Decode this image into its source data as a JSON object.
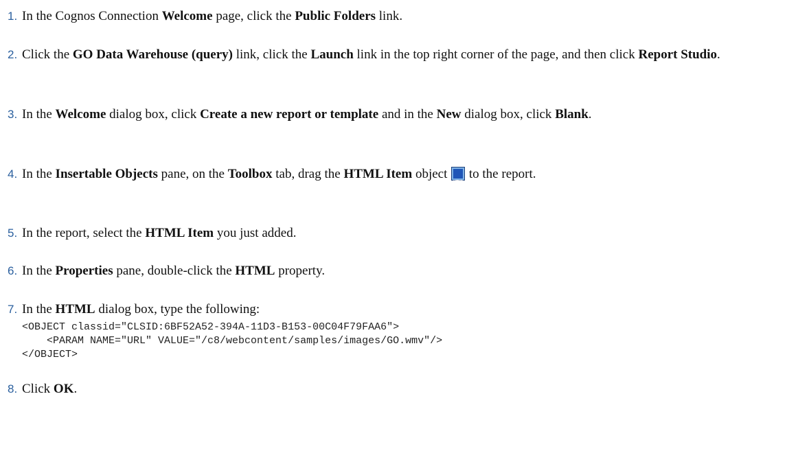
{
  "steps": [
    {
      "num": "1.",
      "parts": [
        {
          "t": "In the Cognos Connection "
        },
        {
          "t": "Welcome",
          "b": true
        },
        {
          "t": " page, click the "
        },
        {
          "t": "Public Folders",
          "b": true
        },
        {
          "t": " link."
        }
      ]
    },
    {
      "num": "2.",
      "parts": [
        {
          "t": "Click the "
        },
        {
          "t": "GO Data Warehouse (query)",
          "b": true
        },
        {
          "t": " link, click the "
        },
        {
          "t": "Launch",
          "b": true
        },
        {
          "t": " link in the top right corner of the page, and then click "
        },
        {
          "t": "Report Studio",
          "b": true
        },
        {
          "t": "."
        }
      ]
    },
    {
      "num": "3.",
      "parts": [
        {
          "t": "In the "
        },
        {
          "t": "Welcome",
          "b": true
        },
        {
          "t": " dialog box, click "
        },
        {
          "t": "Create a new report or template",
          "b": true
        },
        {
          "t": " and in the "
        },
        {
          "t": "New",
          "b": true
        },
        {
          "t": " dialog box, click "
        },
        {
          "t": "Blank",
          "b": true
        },
        {
          "t": "."
        }
      ]
    },
    {
      "num": "4.",
      "parts": [
        {
          "t": "In the "
        },
        {
          "t": "Insertable Objects",
          "b": true
        },
        {
          "t": " pane, on the "
        },
        {
          "t": "Toolbox",
          "b": true
        },
        {
          "t": " tab, drag the "
        },
        {
          "t": "HTML Item",
          "b": true
        },
        {
          "t": " object "
        },
        {
          "icon": "html-item-icon"
        },
        {
          "t": " to the report."
        }
      ]
    },
    {
      "num": "5.",
      "parts": [
        {
          "t": "In the report, select the "
        },
        {
          "t": "HTML Item",
          "b": true
        },
        {
          "t": " you just added."
        }
      ]
    },
    {
      "num": "6.",
      "parts": [
        {
          "t": "In the "
        },
        {
          "t": "Properties",
          "b": true
        },
        {
          "t": " pane, double-click the "
        },
        {
          "t": "HTML",
          "b": true
        },
        {
          "t": " property."
        }
      ]
    },
    {
      "num": "7.",
      "parts": [
        {
          "t": "In the "
        },
        {
          "t": "HTML",
          "b": true
        },
        {
          "t": " dialog box, type the following:"
        }
      ],
      "code": [
        "<OBJECT classid=\"CLSID:6BF52A52-394A-11D3-B153-00C04F79FAA6\">",
        "    <PARAM NAME=\"URL\" VALUE=\"/c8/webcontent/samples/images/GO.wmv\"/>",
        "</OBJECT>"
      ]
    },
    {
      "num": "8.",
      "parts": [
        {
          "t": "Click "
        },
        {
          "t": "OK",
          "b": true
        },
        {
          "t": "."
        }
      ]
    }
  ]
}
